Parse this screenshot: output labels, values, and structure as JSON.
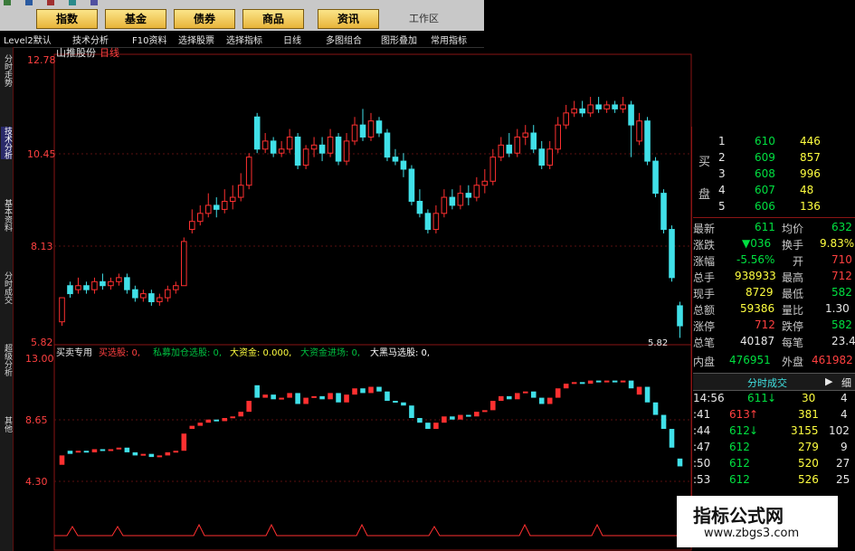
{
  "toolbar": {
    "buttons": [
      "指数",
      "基金",
      "债券",
      "商品",
      "资讯"
    ],
    "workspace": "工作区"
  },
  "menu": [
    "Level2默认",
    "技术分析",
    "F10资料",
    "选择股票",
    "选择指标",
    "日线",
    "多图组合",
    "图形叠加",
    "常用指标"
  ],
  "left_tabs": [
    "分时走势",
    "技术分析",
    "基本资料",
    "分时成交",
    "超级分析",
    "其他"
  ],
  "stock": {
    "name": "山推股份",
    "period": "日线"
  },
  "price_axis": {
    "top": "12.78",
    "t2": "10.45",
    "t3": "8.13",
    "bottom": "5.82",
    "low_mark": "5.82"
  },
  "indicator_axis": {
    "top": "13.00",
    "mid": "8.65",
    "low": "4.30"
  },
  "indicator_legend": [
    {
      "text": "买卖专用",
      "color": "#e8e8e8"
    },
    {
      "text": "买选股: 0,",
      "color": "#ff4040"
    },
    {
      "text": "私募加仓选股: 0,",
      "color": "#00c040"
    },
    {
      "text": "大资金: 0.000,",
      "color": "#ffff40"
    },
    {
      "text": "大资金进场: 0,",
      "color": "#00c040"
    },
    {
      "text": "大黑马选股: 0,",
      "color": "#ffffff"
    }
  ],
  "order_book": {
    "side_label": [
      "买",
      "盘"
    ],
    "rows": [
      {
        "lvl": "1",
        "price": "610",
        "vol": "446"
      },
      {
        "lvl": "2",
        "price": "609",
        "vol": "857"
      },
      {
        "lvl": "3",
        "price": "608",
        "vol": "996"
      },
      {
        "lvl": "4",
        "price": "607",
        "vol": "48"
      },
      {
        "lvl": "5",
        "price": "606",
        "vol": "136"
      }
    ]
  },
  "quote": [
    {
      "l": "最新",
      "v": "611",
      "l2": "均价",
      "v2": "632"
    },
    {
      "l": "涨跌",
      "v": "▼036",
      "l2": "换手",
      "v2": "9.83%"
    },
    {
      "l": "涨幅",
      "v": "-5.56%",
      "l2": "开",
      "v2": "710"
    },
    {
      "l": "总手",
      "v": "938933",
      "l2": "最高",
      "v2": "712"
    },
    {
      "l": "现手",
      "v": "8729",
      "l2": "最低",
      "v2": "582"
    },
    {
      "l": "总额",
      "v": "59386",
      "l2": "量比",
      "v2": "1.30"
    },
    {
      "l": "涨停",
      "v": "712",
      "l2": "跌停",
      "v2": "582"
    },
    {
      "l": "总笔",
      "v": "40187",
      "l2": "每笔",
      "v2": "23.4"
    },
    {
      "l": "内盘",
      "v": "476951",
      "l2": "外盘",
      "v2": "461982"
    }
  ],
  "ticks_header": {
    "title": "分时成交",
    "right": "细"
  },
  "ticks": [
    {
      "t": "14:56",
      "p": "611",
      "dir": "↓",
      "v": "30",
      "n": "4"
    },
    {
      "t": ":41",
      "p": "613",
      "dir": "↑",
      "v": "381",
      "n": "4"
    },
    {
      "t": ":44",
      "p": "612",
      "dir": "↓",
      "v": "3155",
      "n": "102"
    },
    {
      "t": ":47",
      "p": "612",
      "dir": "",
      "v": "279",
      "n": "9"
    },
    {
      "t": ":50",
      "p": "612",
      "dir": "",
      "v": "520",
      "n": "27"
    },
    {
      "t": ":53",
      "p": "612",
      "dir": "",
      "v": "526",
      "n": "25"
    }
  ],
  "watermark": {
    "line1": "指标公式网",
    "line2": "www.zbgs3.com"
  },
  "colors": {
    "up": "#ff3030",
    "down": "#40e0e8",
    "grid": "#7a1010",
    "bg": "#000000"
  },
  "chart_data": {
    "type": "candlestick",
    "y_range": [
      5.82,
      12.78
    ],
    "candles": [
      [
        6.3,
        6.9,
        6.2,
        6.9
      ],
      [
        7.2,
        7.0,
        6.9,
        7.3
      ],
      [
        7.1,
        7.2,
        7.0,
        7.4
      ],
      [
        7.2,
        7.1,
        7.0,
        7.3
      ],
      [
        7.1,
        7.3,
        7.0,
        7.4
      ],
      [
        7.3,
        7.2,
        7.1,
        7.5
      ],
      [
        7.2,
        7.3,
        7.1,
        7.4
      ],
      [
        7.3,
        7.4,
        7.2,
        7.5
      ],
      [
        7.4,
        7.1,
        7.0,
        7.5
      ],
      [
        7.1,
        6.9,
        6.8,
        7.2
      ],
      [
        6.9,
        7.0,
        6.8,
        7.1
      ],
      [
        7.0,
        6.8,
        6.7,
        7.1
      ],
      [
        6.8,
        6.9,
        6.7,
        7.0
      ],
      [
        6.9,
        7.1,
        6.8,
        7.2
      ],
      [
        7.1,
        7.2,
        7.0,
        7.3
      ],
      [
        7.2,
        8.3,
        7.2,
        8.4
      ],
      [
        8.6,
        8.8,
        8.5,
        9.1
      ],
      [
        8.8,
        9.0,
        8.7,
        9.2
      ],
      [
        9.0,
        9.2,
        8.9,
        9.5
      ],
      [
        9.2,
        9.1,
        8.9,
        9.4
      ],
      [
        9.1,
        9.3,
        9.0,
        9.6
      ],
      [
        9.3,
        9.4,
        9.1,
        9.7
      ],
      [
        9.4,
        9.7,
        9.3,
        10.0
      ],
      [
        9.7,
        10.4,
        9.6,
        10.5
      ],
      [
        11.4,
        10.6,
        10.5,
        11.5
      ],
      [
        10.6,
        10.8,
        10.5,
        11.0
      ],
      [
        10.8,
        10.5,
        10.4,
        10.9
      ],
      [
        10.5,
        10.6,
        10.4,
        10.8
      ],
      [
        10.6,
        10.9,
        10.5,
        11.1
      ],
      [
        10.9,
        10.2,
        10.1,
        11.0
      ],
      [
        10.2,
        10.6,
        10.1,
        10.7
      ],
      [
        10.6,
        10.7,
        10.4,
        10.9
      ],
      [
        10.7,
        10.5,
        10.3,
        10.9
      ],
      [
        10.5,
        10.9,
        10.4,
        11.1
      ],
      [
        10.9,
        10.3,
        10.2,
        11.0
      ],
      [
        10.3,
        10.8,
        10.2,
        11.0
      ],
      [
        10.8,
        11.2,
        10.7,
        11.4
      ],
      [
        11.2,
        10.9,
        10.8,
        11.6
      ],
      [
        10.9,
        11.3,
        10.8,
        11.5
      ],
      [
        11.3,
        11.0,
        10.9,
        11.4
      ],
      [
        11.0,
        10.4,
        10.3,
        11.1
      ],
      [
        10.4,
        10.3,
        10.2,
        10.6
      ],
      [
        10.3,
        10.1,
        9.9,
        10.5
      ],
      [
        10.1,
        9.3,
        9.2,
        10.2
      ],
      [
        9.3,
        9.0,
        8.9,
        9.6
      ],
      [
        9.0,
        8.6,
        8.5,
        9.1
      ],
      [
        8.6,
        9.0,
        8.5,
        9.2
      ],
      [
        9.0,
        9.4,
        8.9,
        9.6
      ],
      [
        9.4,
        9.2,
        9.1,
        9.6
      ],
      [
        9.2,
        9.5,
        9.1,
        9.7
      ],
      [
        9.5,
        9.4,
        9.2,
        9.7
      ],
      [
        9.4,
        9.7,
        9.3,
        9.9
      ],
      [
        9.7,
        9.8,
        9.5,
        10.1
      ],
      [
        9.8,
        10.4,
        9.7,
        10.6
      ],
      [
        10.4,
        10.7,
        10.3,
        10.9
      ],
      [
        10.7,
        10.5,
        10.4,
        11.0
      ],
      [
        10.5,
        10.9,
        10.4,
        11.1
      ],
      [
        10.9,
        11.0,
        10.7,
        11.2
      ],
      [
        11.0,
        10.6,
        10.5,
        11.2
      ],
      [
        10.6,
        10.2,
        10.1,
        10.8
      ],
      [
        10.2,
        10.6,
        10.1,
        10.8
      ],
      [
        10.6,
        11.2,
        10.5,
        11.4
      ],
      [
        11.2,
        11.5,
        11.1,
        11.7
      ],
      [
        11.5,
        11.6,
        11.4,
        11.8
      ],
      [
        11.6,
        11.5,
        11.4,
        11.8
      ],
      [
        11.5,
        11.7,
        11.4,
        11.9
      ],
      [
        11.7,
        11.6,
        11.5,
        11.9
      ],
      [
        11.6,
        11.7,
        11.5,
        11.8
      ],
      [
        11.7,
        11.6,
        11.5,
        11.8
      ],
      [
        11.6,
        11.7,
        11.5,
        11.9
      ],
      [
        11.7,
        11.2,
        10.4,
        11.8
      ],
      [
        10.8,
        11.3,
        10.7,
        11.5
      ],
      [
        11.3,
        10.3,
        10.2,
        11.4
      ],
      [
        10.3,
        9.5,
        9.4,
        10.4
      ],
      [
        9.5,
        8.6,
        8.5,
        9.6
      ],
      [
        8.6,
        7.4,
        7.3,
        8.7
      ],
      [
        6.7,
        6.2,
        5.9,
        6.8
      ]
    ]
  }
}
